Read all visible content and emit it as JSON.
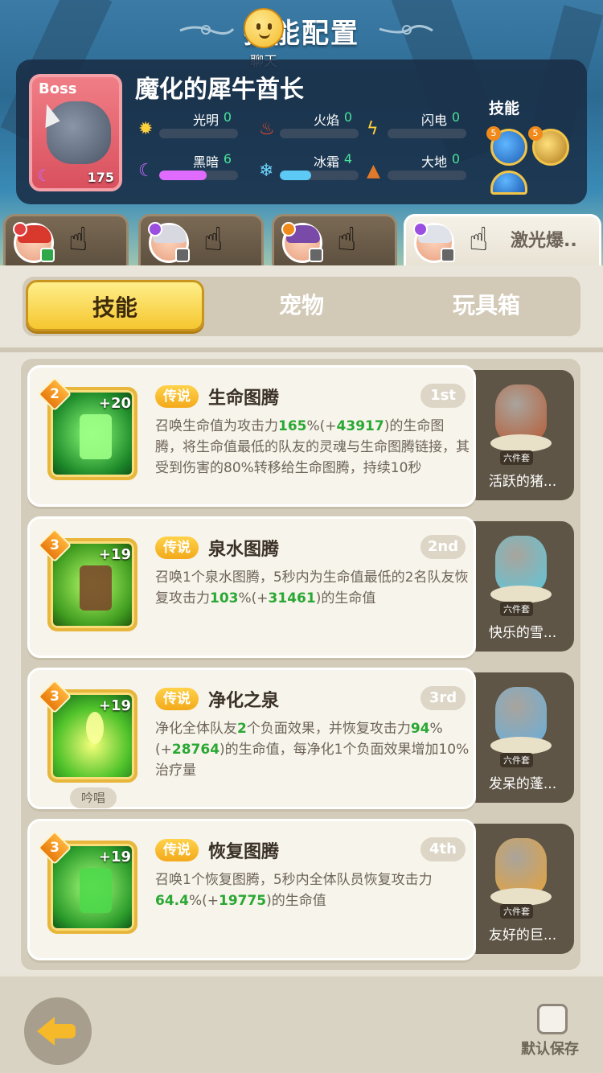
{
  "header": {
    "title": "技能配置",
    "chat_label": "聊天"
  },
  "boss": {
    "tag": "Boss",
    "level": "175",
    "name": "魔化的犀牛酋长",
    "elements": [
      {
        "name": "光明",
        "value": "0",
        "icon": "sun-icon",
        "fill": 0
      },
      {
        "name": "火焰",
        "value": "0",
        "icon": "flame-icon",
        "fill": 0
      },
      {
        "name": "闪电",
        "value": "0",
        "icon": "lightning-icon",
        "fill": 0
      },
      {
        "name": "黑暗",
        "value": "6",
        "icon": "moon-icon",
        "fill": 0.6
      },
      {
        "name": "冰霜",
        "value": "4",
        "icon": "snowflake-icon",
        "fill": 0.4
      },
      {
        "name": "大地",
        "value": "0",
        "icon": "earth-icon",
        "fill": 0
      }
    ],
    "skills_label": "技能"
  },
  "hero_tabs": [
    {
      "hair": "#d9382c"
    },
    {
      "hair": "#d8d8e0"
    },
    {
      "hair": "#7a4aa8"
    },
    {
      "hair": "#e0e2ea",
      "label": "激光爆..",
      "dot": "。"
    }
  ],
  "segments": {
    "skills": "技能",
    "pets": "宠物",
    "toybox": "玩具箱"
  },
  "skills": [
    {
      "level": "2",
      "plus": "+20",
      "rarity": "传说",
      "name": "生命图腾",
      "order": "1st",
      "desc": [
        {
          "t": "召唤生命值为攻击力"
        },
        {
          "t": "165",
          "g": true
        },
        {
          "t": "%(+"
        },
        {
          "t": "43917",
          "g": true
        },
        {
          "t": ")的生命图腾，将生命值最低的队友的灵魂与生命图腾链接，其受到伤害的80%转移给生命图腾，持续10秒"
        }
      ],
      "pet": {
        "name": "活跃的猪...",
        "set": "六件套",
        "color": "#b65d38"
      }
    },
    {
      "level": "3",
      "plus": "+19",
      "rarity": "传说",
      "name": "泉水图腾",
      "order": "2nd",
      "desc": [
        {
          "t": "召唤1个泉水图腾，5秒内为生命值最低的2名队友恢复攻击力"
        },
        {
          "t": "103",
          "g": true
        },
        {
          "t": "%(+"
        },
        {
          "t": "31461",
          "g": true
        },
        {
          "t": ")的生命值"
        }
      ],
      "pet": {
        "name": "快乐的雪...",
        "set": "六件套",
        "color": "#5fc6d8"
      }
    },
    {
      "level": "3",
      "plus": "+19",
      "rarity": "传说",
      "name": "净化之泉",
      "order": "3rd",
      "chant": "吟唱",
      "desc": [
        {
          "t": "净化全体队友"
        },
        {
          "t": "2",
          "g": true
        },
        {
          "t": "个负面效果，并恢复攻击力"
        },
        {
          "t": "94",
          "g": true
        },
        {
          "t": "%(+"
        },
        {
          "t": "28764",
          "g": true
        },
        {
          "t": ")的生命值，每净化1个负面效果增加10%治疗量"
        }
      ],
      "pet": {
        "name": "发呆的蓬...",
        "set": "六件套",
        "color": "#6aaed8"
      }
    },
    {
      "level": "3",
      "plus": "+19",
      "rarity": "传说",
      "name": "恢复图腾",
      "order": "4th",
      "desc": [
        {
          "t": "召唤1个恢复图腾，5秒内全体队员恢复攻击力"
        },
        {
          "t": "64.4",
          "g": true
        },
        {
          "t": "%(+"
        },
        {
          "t": "19775",
          "g": true
        },
        {
          "t": ")的生命值"
        }
      ],
      "pet": {
        "name": "友好的巨...",
        "set": "六件套",
        "color": "#e4a23c"
      }
    }
  ],
  "footer": {
    "save_label": "默认保存"
  }
}
